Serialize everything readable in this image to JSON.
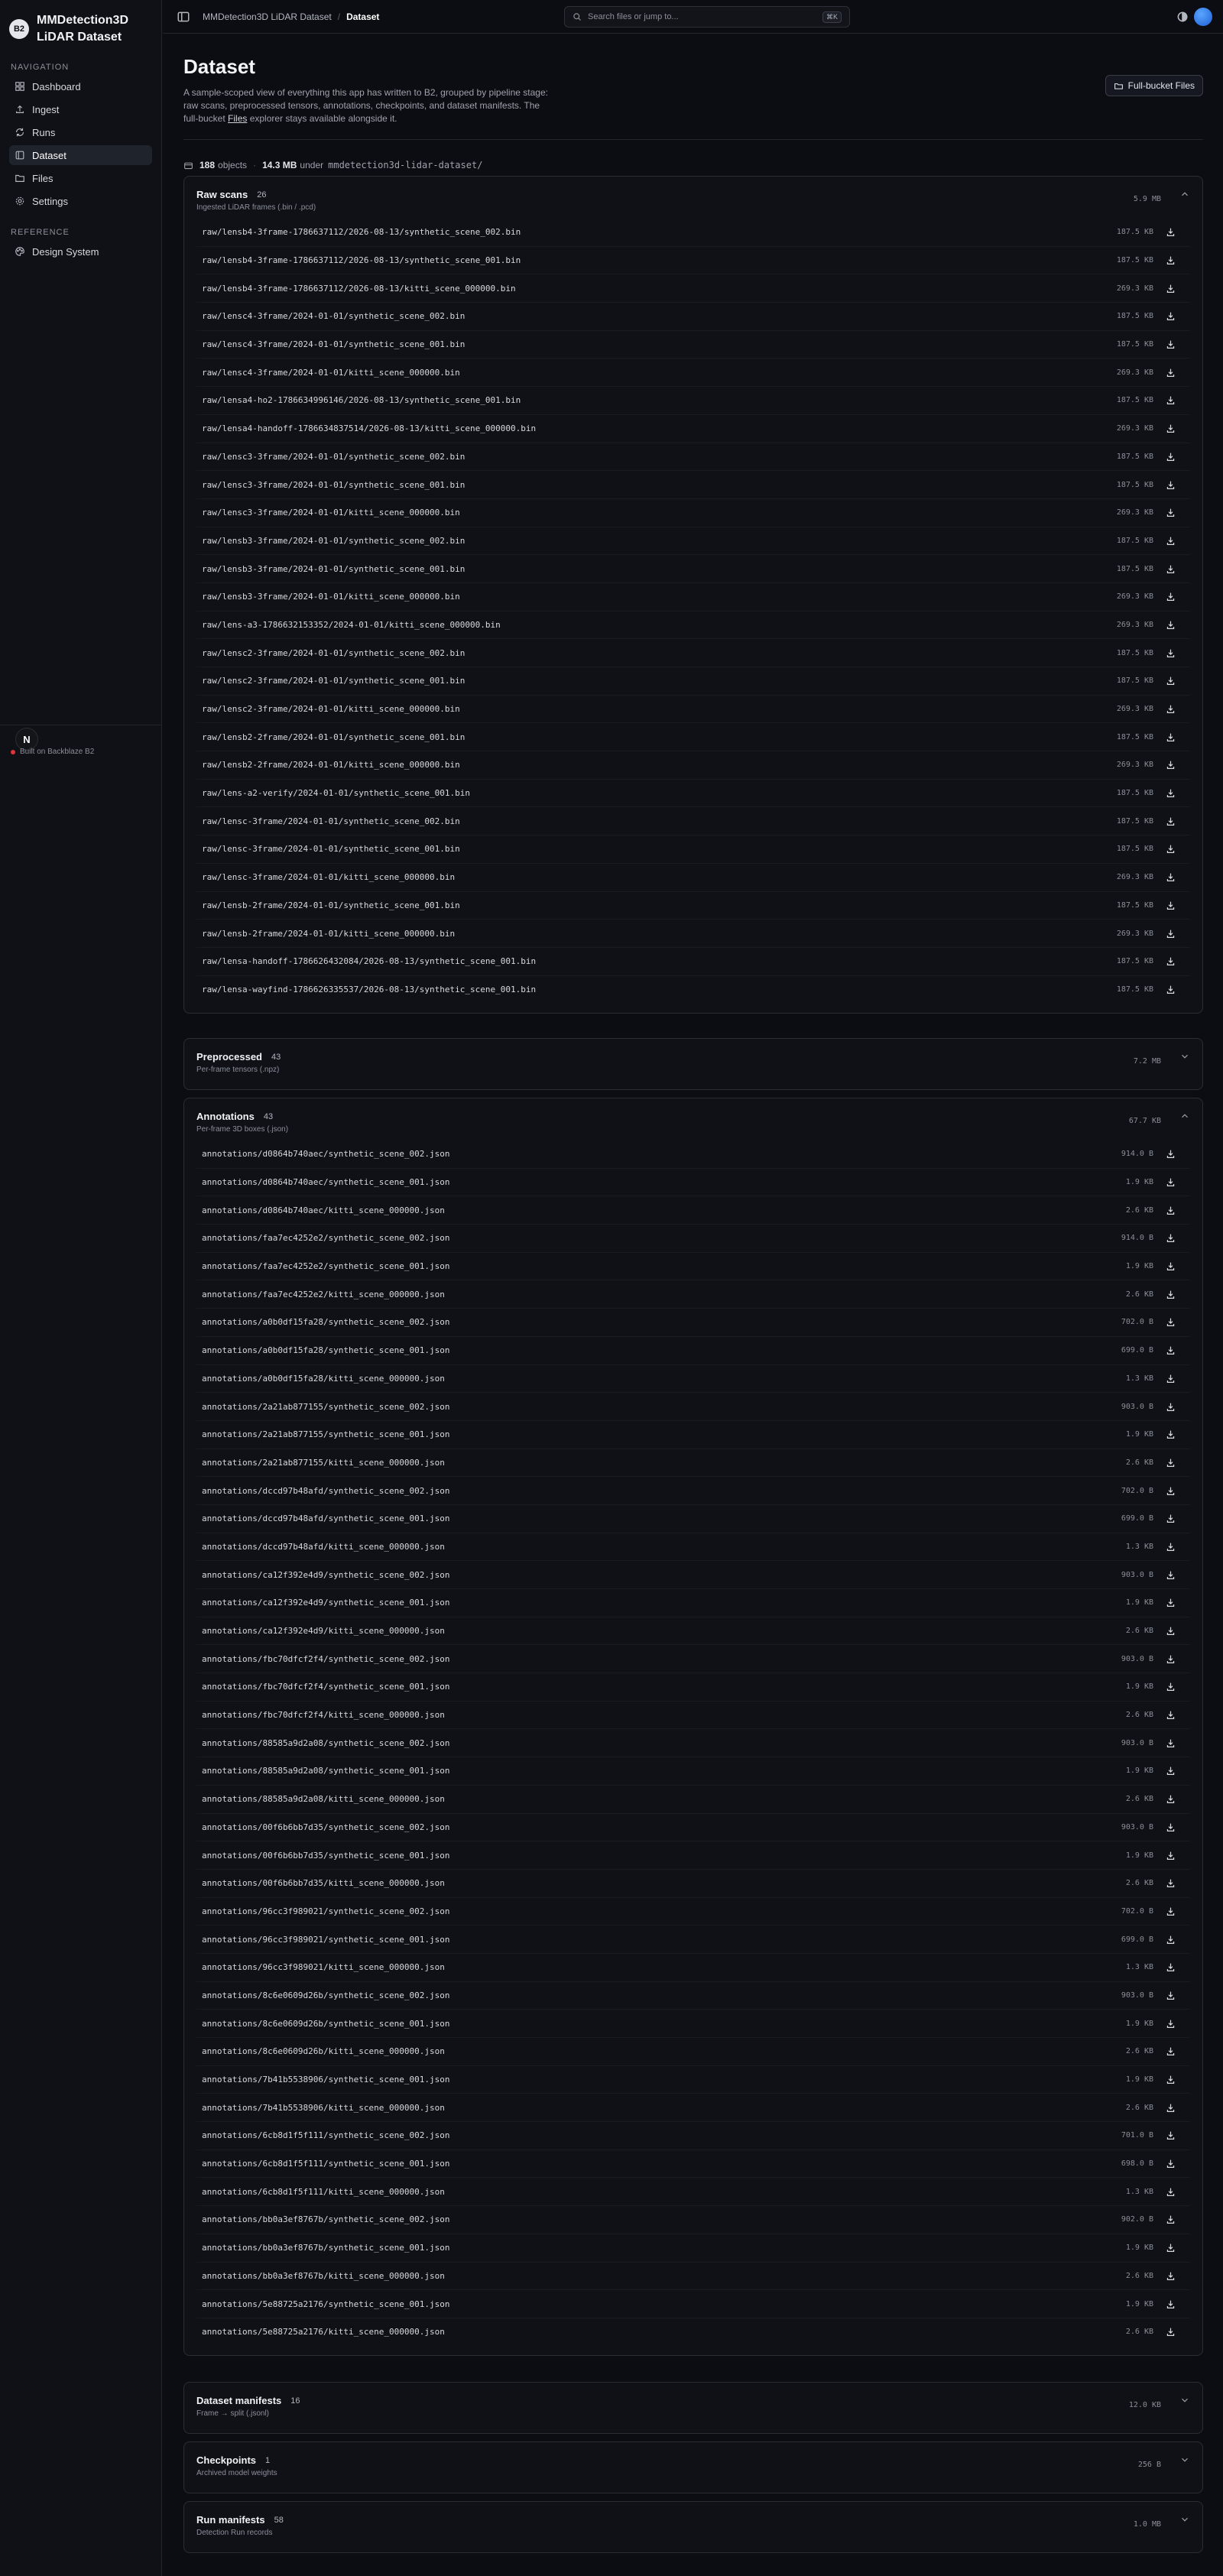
{
  "app": {
    "logo": "B2",
    "title": "MMDetection3D LiDAR Dataset"
  },
  "sidebar": {
    "nav_heading": "NAVIGATION",
    "items": [
      {
        "label": "Dashboard",
        "icon": "dashboard-icon"
      },
      {
        "label": "Ingest",
        "icon": "upload-icon"
      },
      {
        "label": "Runs",
        "icon": "runs-icon"
      },
      {
        "label": "Dataset",
        "icon": "dataset-icon",
        "active": true
      },
      {
        "label": "Files",
        "icon": "files-icon"
      },
      {
        "label": "Settings",
        "icon": "gear-icon"
      }
    ],
    "ref_heading": "REFERENCE",
    "ref_items": [
      {
        "label": "Design System",
        "icon": "palette-icon"
      }
    ],
    "badge": "N",
    "footer": "Built on Backblaze B2"
  },
  "topbar": {
    "breadcrumb": [
      "MMDetection3D LiDAR Dataset",
      "Dataset"
    ],
    "separator": "/",
    "search_placeholder": "Search files or jump to...",
    "search_kbd": "⌘K"
  },
  "page": {
    "title": "Dataset",
    "desc_before": "A sample-scoped view of everything this app has written to B2, grouped by pipeline stage: raw scans, preprocessed tensors, annotations, checkpoints, and dataset manifests. The full-bucket ",
    "desc_link": "Files",
    "desc_after": " explorer stays available alongside it.",
    "full_bucket_button": "Full-bucket Files"
  },
  "summary": {
    "objects_count": "188",
    "objects_label": "objects",
    "size": "14.3 MB",
    "under_label": "under",
    "prefix": "mmdetection3d-lidar-dataset/"
  },
  "sections": [
    {
      "title": "Raw scans",
      "count": "26",
      "subtitle": "Ingested LiDAR frames (.bin / .pcd)",
      "size": "5.9 MB",
      "expanded": true,
      "files": [
        {
          "name": "raw/lensb4-3frame-1786637112/2026-08-13/synthetic_scene_002.bin",
          "size": "187.5 KB"
        },
        {
          "name": "raw/lensb4-3frame-1786637112/2026-08-13/synthetic_scene_001.bin",
          "size": "187.5 KB"
        },
        {
          "name": "raw/lensb4-3frame-1786637112/2026-08-13/kitti_scene_000000.bin",
          "size": "269.3 KB"
        },
        {
          "name": "raw/lensc4-3frame/2024-01-01/synthetic_scene_002.bin",
          "size": "187.5 KB"
        },
        {
          "name": "raw/lensc4-3frame/2024-01-01/synthetic_scene_001.bin",
          "size": "187.5 KB"
        },
        {
          "name": "raw/lensc4-3frame/2024-01-01/kitti_scene_000000.bin",
          "size": "269.3 KB"
        },
        {
          "name": "raw/lensa4-ho2-1786634996146/2026-08-13/synthetic_scene_001.bin",
          "size": "187.5 KB"
        },
        {
          "name": "raw/lensa4-handoff-1786634837514/2026-08-13/kitti_scene_000000.bin",
          "size": "269.3 KB"
        },
        {
          "name": "raw/lensc3-3frame/2024-01-01/synthetic_scene_002.bin",
          "size": "187.5 KB"
        },
        {
          "name": "raw/lensc3-3frame/2024-01-01/synthetic_scene_001.bin",
          "size": "187.5 KB"
        },
        {
          "name": "raw/lensc3-3frame/2024-01-01/kitti_scene_000000.bin",
          "size": "269.3 KB"
        },
        {
          "name": "raw/lensb3-3frame/2024-01-01/synthetic_scene_002.bin",
          "size": "187.5 KB"
        },
        {
          "name": "raw/lensb3-3frame/2024-01-01/synthetic_scene_001.bin",
          "size": "187.5 KB"
        },
        {
          "name": "raw/lensb3-3frame/2024-01-01/kitti_scene_000000.bin",
          "size": "269.3 KB"
        },
        {
          "name": "raw/lens-a3-1786632153352/2024-01-01/kitti_scene_000000.bin",
          "size": "269.3 KB"
        },
        {
          "name": "raw/lensc2-3frame/2024-01-01/synthetic_scene_002.bin",
          "size": "187.5 KB"
        },
        {
          "name": "raw/lensc2-3frame/2024-01-01/synthetic_scene_001.bin",
          "size": "187.5 KB"
        },
        {
          "name": "raw/lensc2-3frame/2024-01-01/kitti_scene_000000.bin",
          "size": "269.3 KB"
        },
        {
          "name": "raw/lensb2-2frame/2024-01-01/synthetic_scene_001.bin",
          "size": "187.5 KB"
        },
        {
          "name": "raw/lensb2-2frame/2024-01-01/kitti_scene_000000.bin",
          "size": "269.3 KB"
        },
        {
          "name": "raw/lens-a2-verify/2024-01-01/synthetic_scene_001.bin",
          "size": "187.5 KB"
        },
        {
          "name": "raw/lensc-3frame/2024-01-01/synthetic_scene_002.bin",
          "size": "187.5 KB"
        },
        {
          "name": "raw/lensc-3frame/2024-01-01/synthetic_scene_001.bin",
          "size": "187.5 KB"
        },
        {
          "name": "raw/lensc-3frame/2024-01-01/kitti_scene_000000.bin",
          "size": "269.3 KB"
        },
        {
          "name": "raw/lensb-2frame/2024-01-01/synthetic_scene_001.bin",
          "size": "187.5 KB"
        },
        {
          "name": "raw/lensb-2frame/2024-01-01/kitti_scene_000000.bin",
          "size": "269.3 KB"
        },
        {
          "name": "raw/lensa-handoff-1786626432084/2026-08-13/synthetic_scene_001.bin",
          "size": "187.5 KB"
        },
        {
          "name": "raw/lensa-wayfind-1786626335537/2026-08-13/synthetic_scene_001.bin",
          "size": "187.5 KB"
        }
      ]
    },
    {
      "title": "Preprocessed",
      "count": "43",
      "subtitle": "Per-frame tensors (.npz)",
      "size": "7.2 MB",
      "expanded": false,
      "files": []
    },
    {
      "title": "Annotations",
      "count": "43",
      "subtitle": "Per-frame 3D boxes (.json)",
      "size": "67.7 KB",
      "expanded": true,
      "files": [
        {
          "name": "annotations/d0864b740aec/synthetic_scene_002.json",
          "size": "914.0 B"
        },
        {
          "name": "annotations/d0864b740aec/synthetic_scene_001.json",
          "size": "1.9 KB"
        },
        {
          "name": "annotations/d0864b740aec/kitti_scene_000000.json",
          "size": "2.6 KB"
        },
        {
          "name": "annotations/faa7ec4252e2/synthetic_scene_002.json",
          "size": "914.0 B"
        },
        {
          "name": "annotations/faa7ec4252e2/synthetic_scene_001.json",
          "size": "1.9 KB"
        },
        {
          "name": "annotations/faa7ec4252e2/kitti_scene_000000.json",
          "size": "2.6 KB"
        },
        {
          "name": "annotations/a0b0df15fa28/synthetic_scene_002.json",
          "size": "702.0 B"
        },
        {
          "name": "annotations/a0b0df15fa28/synthetic_scene_001.json",
          "size": "699.0 B"
        },
        {
          "name": "annotations/a0b0df15fa28/kitti_scene_000000.json",
          "size": "1.3 KB"
        },
        {
          "name": "annotations/2a21ab877155/synthetic_scene_002.json",
          "size": "903.0 B"
        },
        {
          "name": "annotations/2a21ab877155/synthetic_scene_001.json",
          "size": "1.9 KB"
        },
        {
          "name": "annotations/2a21ab877155/kitti_scene_000000.json",
          "size": "2.6 KB"
        },
        {
          "name": "annotations/dccd97b48afd/synthetic_scene_002.json",
          "size": "702.0 B"
        },
        {
          "name": "annotations/dccd97b48afd/synthetic_scene_001.json",
          "size": "699.0 B"
        },
        {
          "name": "annotations/dccd97b48afd/kitti_scene_000000.json",
          "size": "1.3 KB"
        },
        {
          "name": "annotations/ca12f392e4d9/synthetic_scene_002.json",
          "size": "903.0 B"
        },
        {
          "name": "annotations/ca12f392e4d9/synthetic_scene_001.json",
          "size": "1.9 KB"
        },
        {
          "name": "annotations/ca12f392e4d9/kitti_scene_000000.json",
          "size": "2.6 KB"
        },
        {
          "name": "annotations/fbc70dfcf2f4/synthetic_scene_002.json",
          "size": "903.0 B"
        },
        {
          "name": "annotations/fbc70dfcf2f4/synthetic_scene_001.json",
          "size": "1.9 KB"
        },
        {
          "name": "annotations/fbc70dfcf2f4/kitti_scene_000000.json",
          "size": "2.6 KB"
        },
        {
          "name": "annotations/88585a9d2a08/synthetic_scene_002.json",
          "size": "903.0 B"
        },
        {
          "name": "annotations/88585a9d2a08/synthetic_scene_001.json",
          "size": "1.9 KB"
        },
        {
          "name": "annotations/88585a9d2a08/kitti_scene_000000.json",
          "size": "2.6 KB"
        },
        {
          "name": "annotations/00f6b6bb7d35/synthetic_scene_002.json",
          "size": "903.0 B"
        },
        {
          "name": "annotations/00f6b6bb7d35/synthetic_scene_001.json",
          "size": "1.9 KB"
        },
        {
          "name": "annotations/00f6b6bb7d35/kitti_scene_000000.json",
          "size": "2.6 KB"
        },
        {
          "name": "annotations/96cc3f989021/synthetic_scene_002.json",
          "size": "702.0 B"
        },
        {
          "name": "annotations/96cc3f989021/synthetic_scene_001.json",
          "size": "699.0 B"
        },
        {
          "name": "annotations/96cc3f989021/kitti_scene_000000.json",
          "size": "1.3 KB"
        },
        {
          "name": "annotations/8c6e0609d26b/synthetic_scene_002.json",
          "size": "903.0 B"
        },
        {
          "name": "annotations/8c6e0609d26b/synthetic_scene_001.json",
          "size": "1.9 KB"
        },
        {
          "name": "annotations/8c6e0609d26b/kitti_scene_000000.json",
          "size": "2.6 KB"
        },
        {
          "name": "annotations/7b41b5538906/synthetic_scene_001.json",
          "size": "1.9 KB"
        },
        {
          "name": "annotations/7b41b5538906/kitti_scene_000000.json",
          "size": "2.6 KB"
        },
        {
          "name": "annotations/6cb8d1f5f111/synthetic_scene_002.json",
          "size": "701.0 B"
        },
        {
          "name": "annotations/6cb8d1f5f111/synthetic_scene_001.json",
          "size": "698.0 B"
        },
        {
          "name": "annotations/6cb8d1f5f111/kitti_scene_000000.json",
          "size": "1.3 KB"
        },
        {
          "name": "annotations/bb0a3ef8767b/synthetic_scene_002.json",
          "size": "902.0 B"
        },
        {
          "name": "annotations/bb0a3ef8767b/synthetic_scene_001.json",
          "size": "1.9 KB"
        },
        {
          "name": "annotations/bb0a3ef8767b/kitti_scene_000000.json",
          "size": "2.6 KB"
        },
        {
          "name": "annotations/5e88725a2176/synthetic_scene_001.json",
          "size": "1.9 KB"
        },
        {
          "name": "annotations/5e88725a2176/kitti_scene_000000.json",
          "size": "2.6 KB"
        }
      ]
    },
    {
      "title": "Dataset manifests",
      "count": "16",
      "subtitle": "Frame → split (.jsonl)",
      "size": "12.0 KB",
      "expanded": false,
      "files": []
    },
    {
      "title": "Checkpoints",
      "count": "1",
      "subtitle": "Archived model weights",
      "size": "256 B",
      "expanded": false,
      "files": []
    },
    {
      "title": "Run manifests",
      "count": "58",
      "subtitle": "Detection Run records",
      "size": "1.0 MB",
      "expanded": false,
      "files": []
    }
  ]
}
